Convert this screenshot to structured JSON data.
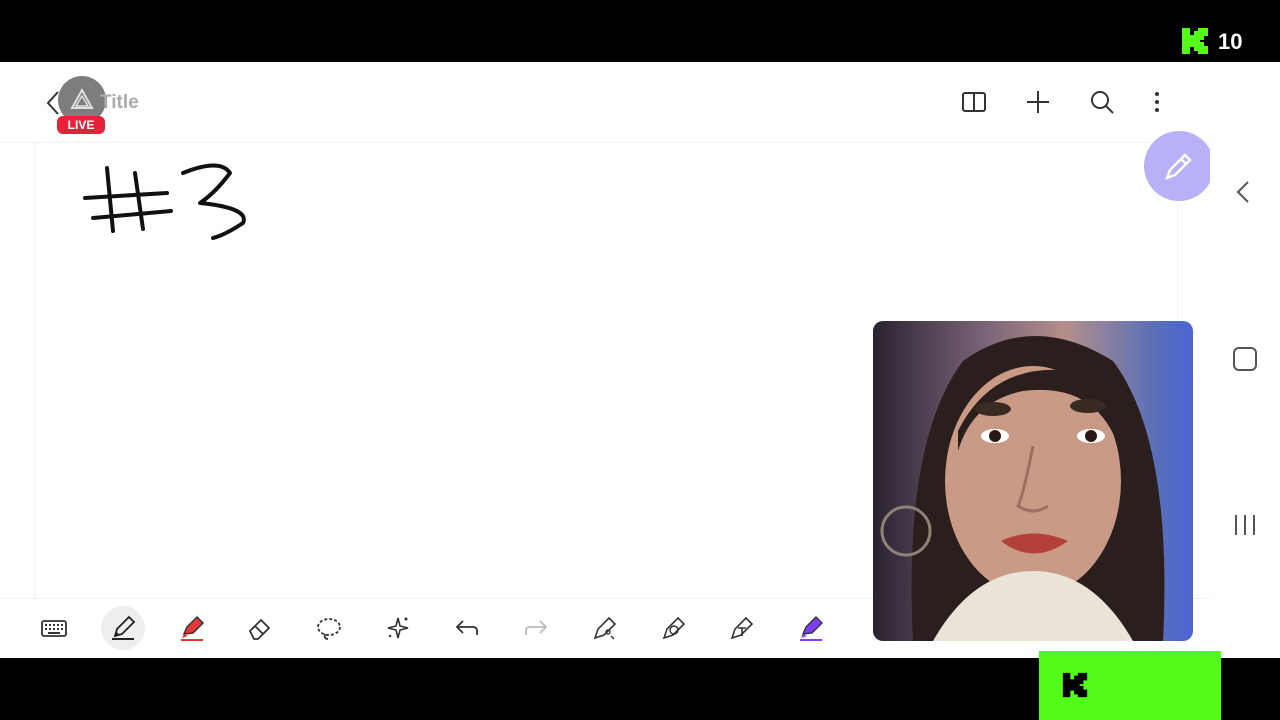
{
  "status_bar": {
    "viewer_count": "10",
    "brand_color": "#53fc18"
  },
  "header": {
    "title": "Title",
    "live_badge": "LIVE",
    "icons": [
      "book-icon",
      "plus-icon",
      "search-icon",
      "more-vert-icon"
    ]
  },
  "canvas": {
    "handwritten_text": "#3"
  },
  "toolbar": {
    "tools": [
      "keyboard-icon",
      "pen-icon",
      "highlighter-icon",
      "eraser-icon",
      "lasso-icon",
      "ai-sparkle-icon",
      "undo-icon",
      "redo-icon",
      "pen-settings-icon",
      "shape-pen-icon",
      "text-pen-icon",
      "purple-pen-icon"
    ]
  },
  "nav": {
    "icons": [
      "back-chevron-icon",
      "home-icon",
      "recents-icon"
    ]
  },
  "colors": {
    "accent_purple": "#b7b1f7",
    "live_red": "#e8213b",
    "kick_green": "#53fc18"
  }
}
